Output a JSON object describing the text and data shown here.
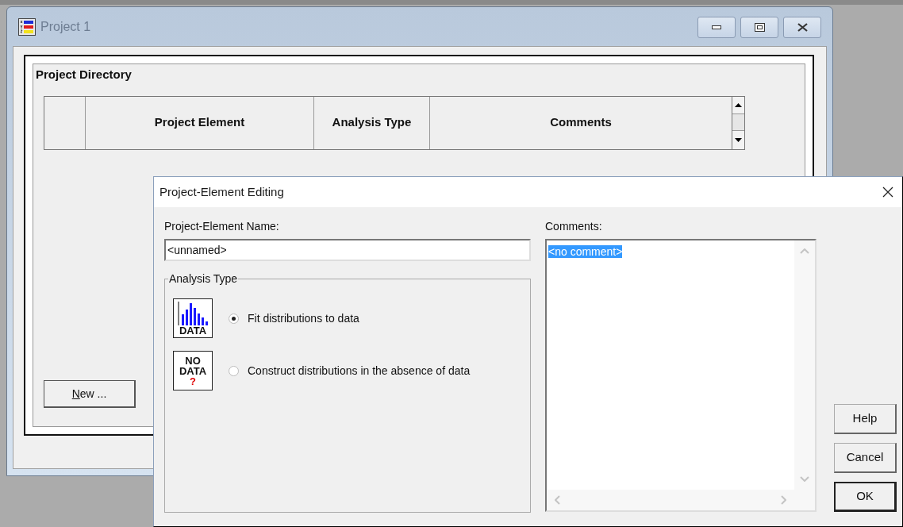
{
  "project_window": {
    "title": "Project 1",
    "directory": {
      "title": "Project Directory",
      "columns": [
        {
          "label": "Project Element"
        },
        {
          "label": "Analysis Type"
        },
        {
          "label": "Comments"
        }
      ]
    },
    "new_button": "New ..."
  },
  "dialog": {
    "title": "Project-Element Editing",
    "name_label": "Project-Element Name:",
    "name_value": "<unnamed>",
    "analysis_type": {
      "title": "Analysis Type",
      "options": [
        {
          "kind": "data",
          "icon_lines": [
            "DATA"
          ],
          "label": "Fit distributions to data",
          "selected": true
        },
        {
          "kind": "no_data",
          "icon_lines": [
            "NO",
            "DATA",
            "?"
          ],
          "label": "Construct distributions in the absence of data",
          "selected": false
        }
      ]
    },
    "comments_label": "Comments:",
    "comments_value": "<no comment>",
    "comments_text_selected": true,
    "buttons": [
      {
        "label": "Help",
        "default": false
      },
      {
        "label": "Cancel",
        "default": false
      },
      {
        "label": "OK",
        "default": true
      }
    ]
  }
}
